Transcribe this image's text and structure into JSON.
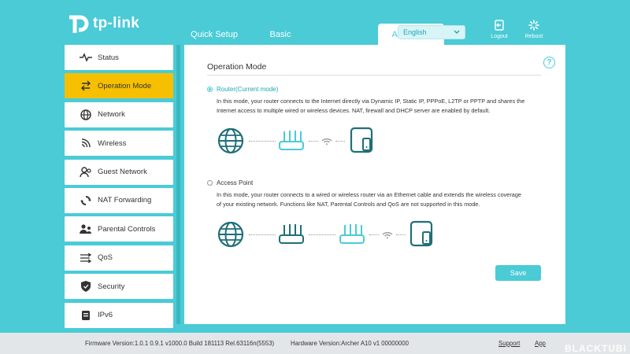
{
  "brand": {
    "name": "tp-link"
  },
  "tabs": [
    {
      "label": "Quick Setup"
    },
    {
      "label": "Basic"
    },
    {
      "label": "Advanced"
    }
  ],
  "language": {
    "selected": "English"
  },
  "header_buttons": {
    "logout": "Logout",
    "reboot": "Reboot"
  },
  "sidebar": {
    "items": [
      {
        "label": "Status",
        "icon": "pulse-icon"
      },
      {
        "label": "Operation Mode",
        "icon": "swap-icon"
      },
      {
        "label": "Network",
        "icon": "globe-icon"
      },
      {
        "label": "Wireless",
        "icon": "wireless-icon"
      },
      {
        "label": "Guest Network",
        "icon": "guest-icon"
      },
      {
        "label": "NAT Forwarding",
        "icon": "nat-icon"
      },
      {
        "label": "Parental Controls",
        "icon": "parental-icon"
      },
      {
        "label": "QoS",
        "icon": "qos-icon"
      },
      {
        "label": "Security",
        "icon": "shield-icon"
      },
      {
        "label": "IPv6",
        "icon": "ipv6-icon"
      }
    ]
  },
  "main": {
    "title": "Operation Mode",
    "router_option": {
      "label": "Router(Current mode)",
      "desc1": "In this mode, your router connects to the Internet directly via Dynamic IP, Static IP, PPPoE, L2TP or PPTP and shares the",
      "desc2": "Internet access to multiple wired or wireless devices. NAT, firewall and DHCP server are enabled by default."
    },
    "ap_option": {
      "label": "Access Point",
      "desc1": "In this mode, your router connects to a wired or wireless router via an Ethernet cable and extends the wireless coverage",
      "desc2": "of your existing network. Functions like NAT, Parental Controls and QoS are not supported in this mode."
    },
    "save_label": "Save"
  },
  "footer": {
    "firmware": "Firmware Version:1.0.1 0.9.1 v1000.0 Build 181113 Rel.63116n(5553)",
    "hardware": "Hardware Version:Archer A10 v1 00000000",
    "support": "Support",
    "app": "App"
  },
  "watermark": "BLACKTUBI",
  "colors": {
    "accent": "#4acbd6",
    "active": "#f6c000",
    "icon_dark": "#1f6f78"
  }
}
